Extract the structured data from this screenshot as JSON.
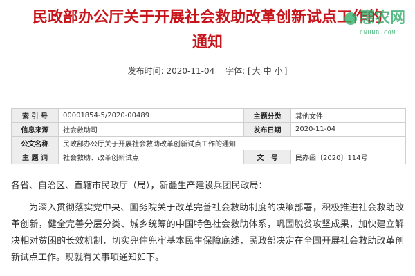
{
  "document": {
    "title_line1": "民政部办公厅关于开展社会救助改革创新试点工作的",
    "title_line2": "通知",
    "published_label": "发布时间:",
    "published_date": "2020-11-04",
    "font_label": "字体:",
    "font_bracket_open": "[",
    "font_large": "大",
    "font_medium": "中",
    "font_small": "小",
    "font_bracket_close": "]",
    "salutation": "各省、自治区、直辖市民政厅（局），新疆生产建设兵团民政局：",
    "body_paragraph": "为深入贯彻落实党中央、国务院关于改革完善社会救助制度的决策部署，积极推进社会救助改革创新，健全完善分层分类、城乡统筹的中国特色社会救助体系，巩固脱贫攻坚成果，加快建立解决相对贫困的长效机制，切实兜住兜牢基本民生保障底线，民政部决定在全国开展社会救助改革创新试点工作。现就有关事项通知如下。"
  },
  "info_table": {
    "index_label": "索 引 号",
    "index_value": "00001854-5/2020-00489",
    "category_label": "主题分类",
    "category_value": "其他文件",
    "source_label": "信息来源",
    "source_value": "社会救助司",
    "date_label": "发布日期",
    "date_value": "2020-11-04",
    "name_label": "公文名称",
    "name_value": "民政部办公厅关于开展社会救助改革创新试点工作的通知",
    "keywords_label": "主 题 词",
    "keywords_value": "社会救助、改革创新试点",
    "docno_label": "文　号",
    "docno_value": "民办函〔2020〕114号"
  },
  "watermark": {
    "name": "惠农网",
    "domain": "CNHNB.COM",
    "color": "#2aa866"
  },
  "colors": {
    "title": "#c8141b",
    "label_bg": "#ededed"
  }
}
